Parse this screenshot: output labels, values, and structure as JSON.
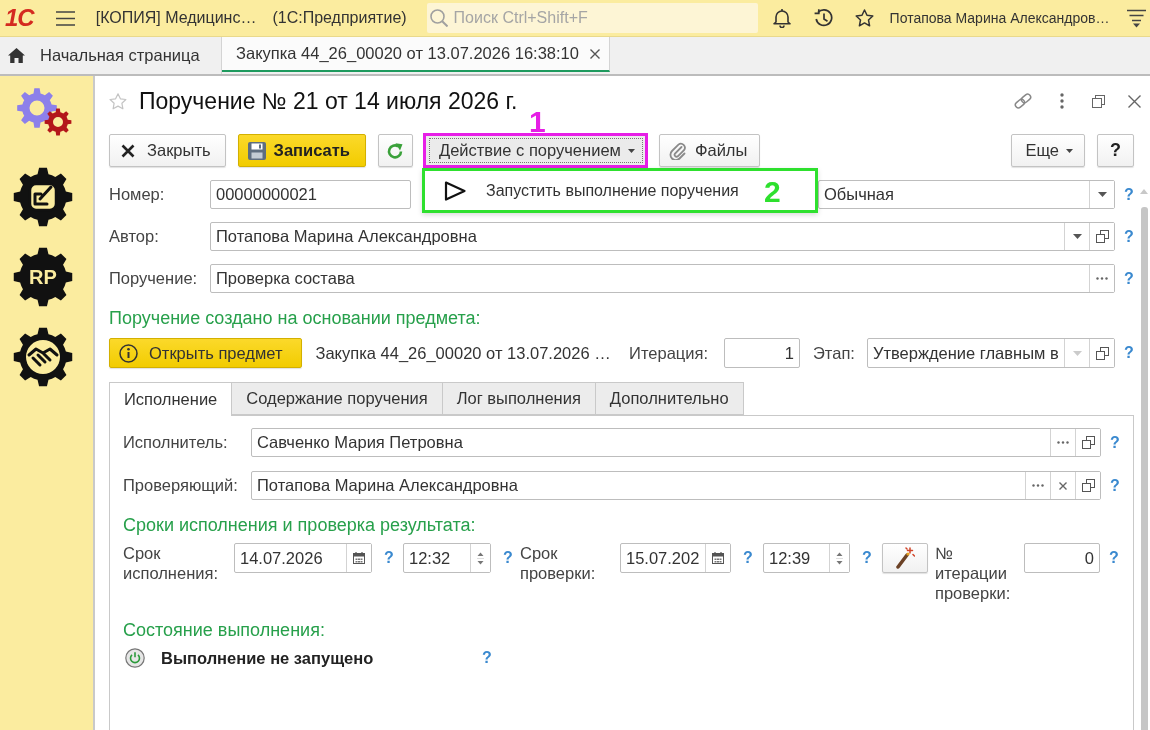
{
  "app_bar": {
    "logo": "1С",
    "title": "[КОПИЯ] Медицинс…",
    "platform": "(1С:Предприятие)",
    "search": {
      "placeholder": "Поиск Ctrl+Shift+F"
    },
    "user": "Потапова Марина Александров…"
  },
  "open_tabs": [
    {
      "kind": "home",
      "label": "Начальная страница",
      "selected": false
    },
    {
      "kind": "document",
      "label": "Закупка 44_26_00020 от 13.07.2026 16:38:10",
      "selected": true
    }
  ],
  "sidebar": {
    "items": [
      {
        "kind": "gears"
      },
      {
        "kind": "checklist"
      },
      {
        "kind": "label",
        "label": "RP"
      },
      {
        "kind": "handshake"
      }
    ]
  },
  "form": {
    "title": "Поручение № 21 от 14 июля 2026 г.",
    "favorite": false,
    "toolbar": {
      "buttons": [
        {
          "kind": "close",
          "label": "Закрыть"
        },
        {
          "kind": "save",
          "label": "Записать"
        },
        {
          "kind": "refresh"
        },
        {
          "kind": "dropdown",
          "label": "Действие с поручением",
          "expanded": true,
          "highlight": {
            "label": "1",
            "color": "#e61ee6"
          },
          "menu": {
            "items": [
              {
                "kind": "play",
                "label": "Запустить выполнение поручения"
              }
            ],
            "highlight": {
              "label": "2",
              "color": "#2ee02e"
            }
          }
        },
        {
          "kind": "attach",
          "label": "Файлы"
        }
      ],
      "right_buttons": [
        {
          "kind": "dropdown",
          "label": "Еще",
          "expanded": false
        },
        {
          "kind": "help",
          "label": "?"
        }
      ]
    },
    "rows": [
      {
        "fields": [
          {
            "label": "Номер:",
            "kind": "text",
            "value": "00000000021"
          },
          {
            "kind": "select",
            "value": "Обычная",
            "dropdown_disabled": false,
            "help": "?"
          }
        ]
      },
      {
        "fields": [
          {
            "label": "Автор:",
            "kind": "select_open",
            "value": "Потапова Марина Александровна",
            "dropdown_disabled": false,
            "help": "?"
          }
        ]
      },
      {
        "fields": [
          {
            "label": "Поручение:",
            "kind": "choose",
            "value": "Проверка состава",
            "help": "?"
          }
        ]
      }
    ],
    "basis": {
      "heading": "Поручение создано на основании предмета:",
      "open_button": "Открыть предмет",
      "subject": "Закупка 44_26_00020 от 13.07.2026 …",
      "fields": [
        {
          "label": "Итерация:",
          "kind": "number",
          "value": "1"
        },
        {
          "label": "Этап:",
          "kind": "select_open",
          "value": "Утверждение главным в",
          "dropdown_disabled": true,
          "help": "?"
        }
      ]
    },
    "tabs": [
      {
        "label": "Исполнение",
        "selected": true
      },
      {
        "label": "Содержание поручения",
        "selected": false
      },
      {
        "label": "Лог выполнения",
        "selected": false
      },
      {
        "label": "Дополнительно",
        "selected": false
      }
    ],
    "execution": {
      "fields": [
        {
          "label": "Исполнитель:",
          "kind": "choose_open",
          "value": "Савченко Мария Петровна",
          "help": "?"
        },
        {
          "label": "Проверяющий:",
          "kind": "choose_clear_open",
          "value": "Потапова Марина Александровна",
          "help": "?"
        }
      ],
      "deadlines": {
        "heading": "Сроки исполнения и проверка результата:",
        "items": [
          {
            "label": "Срок исполнения:",
            "fields": [
              {
                "kind": "date",
                "value": "14.07.2026",
                "help": "?"
              },
              {
                "kind": "time",
                "value": "12:32",
                "help": "?"
              }
            ]
          },
          {
            "label": "Срок проверки:",
            "fields": [
              {
                "kind": "date",
                "value": "15.07.202",
                "help": "?"
              },
              {
                "kind": "time",
                "value": "12:39",
                "help": "?"
              }
            ]
          }
        ],
        "iteration_check": {
          "label": "№ итерации проверки:",
          "kind": "number",
          "value": "0",
          "help": "?"
        }
      },
      "status": {
        "heading": "Состояние выполнения:",
        "text": "Выполнение не запущено",
        "help": "?"
      }
    }
  }
}
